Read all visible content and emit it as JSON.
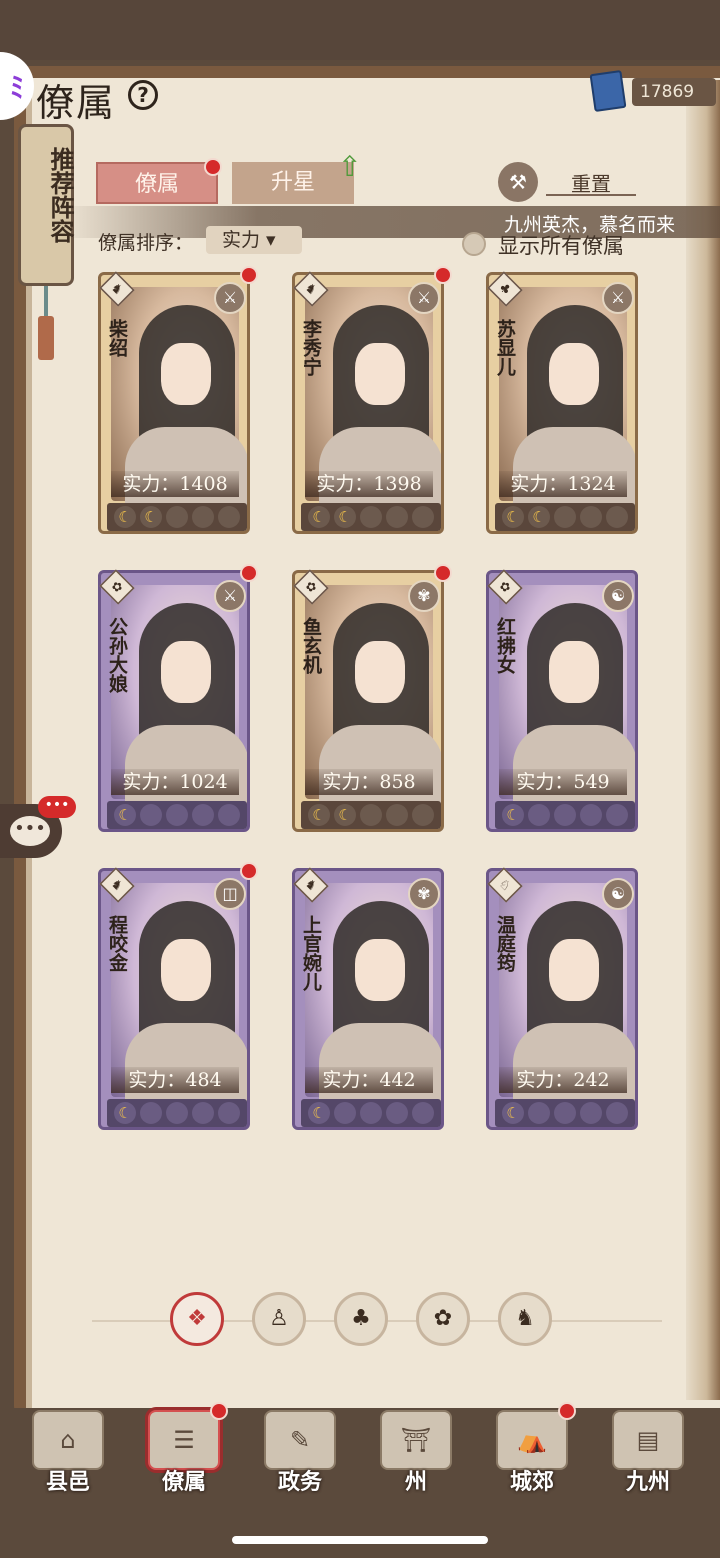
{
  "header": {
    "title": "僚属",
    "help_icon": "?",
    "app_badge": "ﾐ",
    "currency": "17869"
  },
  "recommend": {
    "label": "推荐阵容"
  },
  "tabs": [
    {
      "label": "僚属",
      "active": true,
      "badge": true
    },
    {
      "label": "升星",
      "active": false,
      "badge": false
    }
  ],
  "reset": {
    "label": "重置",
    "icon": "⚒"
  },
  "marquee": "九州英杰，慕名而来",
  "sort": {
    "label": "僚属排序：",
    "value": "实力 ▾"
  },
  "show_all": {
    "label": "显示所有僚属",
    "checked": false
  },
  "cards": [
    {
      "name": "柴绍",
      "power": "实力：1408",
      "stars": 2,
      "frame": "gold",
      "badge": true,
      "class_icon": "♞",
      "skill_icon": "⚔"
    },
    {
      "name": "李秀宁",
      "power": "实力：1398",
      "stars": 2,
      "frame": "gold",
      "badge": true,
      "class_icon": "♞",
      "skill_icon": "⚔"
    },
    {
      "name": "苏显儿",
      "power": "实力：1324",
      "stars": 2,
      "frame": "gold",
      "badge": false,
      "class_icon": "♣",
      "skill_icon": "⚔"
    },
    {
      "name": "公孙大娘",
      "power": "实力：1024",
      "stars": 1,
      "frame": "purple",
      "badge": true,
      "class_icon": "✿",
      "skill_icon": "⚔"
    },
    {
      "name": "鱼玄机",
      "power": "实力：858",
      "stars": 2,
      "frame": "gold",
      "badge": true,
      "class_icon": "✿",
      "skill_icon": "✾"
    },
    {
      "name": "红拂女",
      "power": "实力：549",
      "stars": 1,
      "frame": "purple",
      "badge": false,
      "class_icon": "✿",
      "skill_icon": "☯"
    },
    {
      "name": "程咬金",
      "power": "实力：484",
      "stars": 1,
      "frame": "purple",
      "badge": true,
      "class_icon": "♞",
      "skill_icon": "◫"
    },
    {
      "name": "上官婉儿",
      "power": "实力：442",
      "stars": 1,
      "frame": "purple",
      "badge": false,
      "class_icon": "♞",
      "skill_icon": "✾"
    },
    {
      "name": "温庭筠",
      "power": "实力：242",
      "stars": 1,
      "frame": "purple",
      "badge": false,
      "class_icon": "♘",
      "skill_icon": "☯"
    }
  ],
  "filters": [
    {
      "icon": "❖",
      "active": true
    },
    {
      "icon": "♙",
      "active": false
    },
    {
      "icon": "♣",
      "active": false
    },
    {
      "icon": "✿",
      "active": false
    },
    {
      "icon": "♞",
      "active": false
    }
  ],
  "chat": {
    "icon": "•••",
    "badge": "•••"
  },
  "nav": [
    {
      "label": "县邑",
      "icon": "⌂",
      "badge": false,
      "active": false
    },
    {
      "label": "僚属",
      "icon": "☰",
      "badge": true,
      "active": true
    },
    {
      "label": "政务",
      "icon": "✎",
      "badge": false,
      "active": false
    },
    {
      "label": "州",
      "icon": "⛩",
      "badge": false,
      "active": false
    },
    {
      "label": "城郊",
      "icon": "⛺",
      "badge": true,
      "active": false
    },
    {
      "label": "九州",
      "icon": "▤",
      "badge": false,
      "active": false
    }
  ],
  "colors": {
    "badge": "#d52a2a",
    "page": "#efe6d6",
    "frame_wood": "#7a5a3f",
    "tab_active": "#d68f86"
  }
}
